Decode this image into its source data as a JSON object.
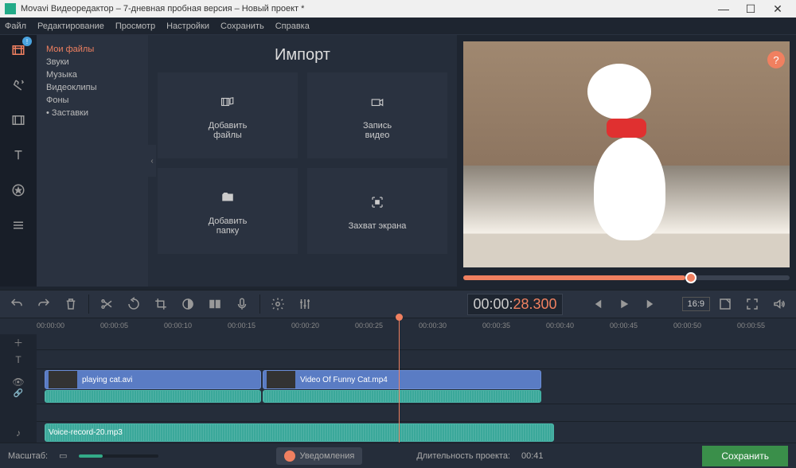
{
  "window": {
    "title": "Movavi Видеоредактор – 7-дневная пробная версия – Новый проект *"
  },
  "menu": [
    "Файл",
    "Редактирование",
    "Просмотр",
    "Настройки",
    "Сохранить",
    "Справка"
  ],
  "import": {
    "title": "Импорт",
    "categories": [
      "Мои файлы",
      "Звуки",
      "Музыка",
      "Видеоклипы",
      "Фоны",
      "Заставки"
    ],
    "tiles": {
      "add_files": "Добавить\nфайлы",
      "record_video": "Запись\nвидео",
      "add_folder": "Добавить\nпапку",
      "screen_capture": "Захват экрана"
    }
  },
  "playback": {
    "timecode_prefix": "00:00:",
    "timecode_active": "28.300",
    "aspect": "16:9"
  },
  "ruler": [
    "00:00:00",
    "00:00:05",
    "00:00:10",
    "00:00:15",
    "00:00:20",
    "00:00:25",
    "00:00:30",
    "00:00:35",
    "00:00:40",
    "00:00:45",
    "00:00:50",
    "00:00:55"
  ],
  "clips": {
    "video1": "playing cat.avi",
    "video2": "Video Of Funny Cat.mp4",
    "audio1": "Voice-record-20.mp3"
  },
  "status": {
    "zoom_label": "Масштаб:",
    "notifications": "Уведомления",
    "duration_label": "Длительность проекта:",
    "duration_value": "00:41",
    "save": "Сохранить"
  },
  "help": "?"
}
